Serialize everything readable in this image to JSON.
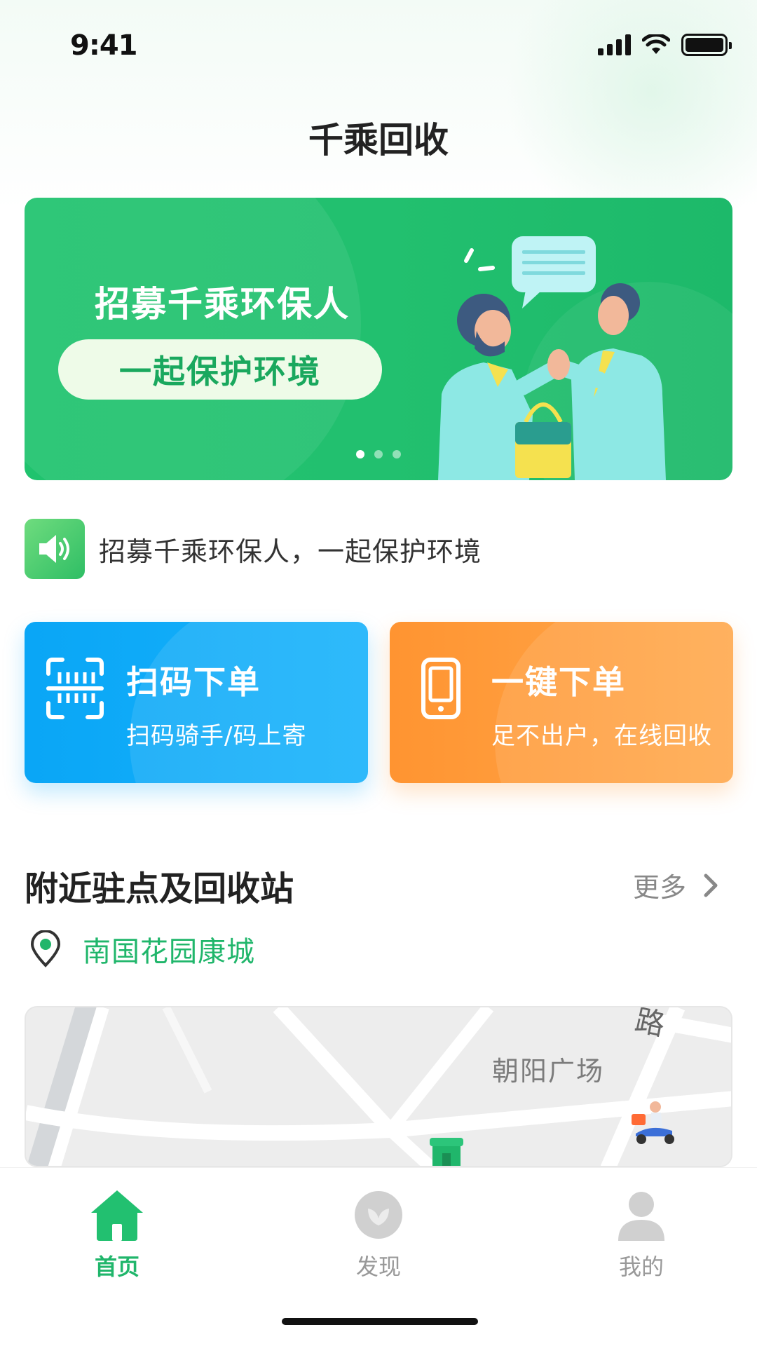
{
  "status_bar": {
    "time": "9:41"
  },
  "header": {
    "title": "千乘回收"
  },
  "banner": {
    "headline": "招募千乘环保人",
    "button_label": "一起保护环境",
    "page_count": 3,
    "active_index": 0
  },
  "notice": {
    "text": "招募千乘环保人，一起保护环境",
    "icon": "speaker-icon"
  },
  "actions": [
    {
      "title": "扫码下单",
      "subtitle": "扫码骑手/码上寄",
      "icon": "scan-icon",
      "color": "#0aa6f6"
    },
    {
      "title": "一键下单",
      "subtitle": "足不出户，在线回收",
      "icon": "phone-icon",
      "color": "#ff9431"
    }
  ],
  "nearby": {
    "title": "附近驻点及回收站",
    "more_label": "更多",
    "location": "南国花园康城",
    "map": {
      "place_label": "朝阳广场",
      "road_label": "路"
    }
  },
  "tabbar": {
    "items": [
      {
        "label": "首页",
        "icon": "home-icon",
        "active": true
      },
      {
        "label": "发现",
        "icon": "discover-icon",
        "active": false
      },
      {
        "label": "我的",
        "icon": "profile-icon",
        "active": false
      }
    ]
  },
  "colors": {
    "brand": "#20b66b",
    "scan_card": "#0aa6f6",
    "order_card": "#ff9431",
    "inactive_tab": "#cccccc"
  }
}
